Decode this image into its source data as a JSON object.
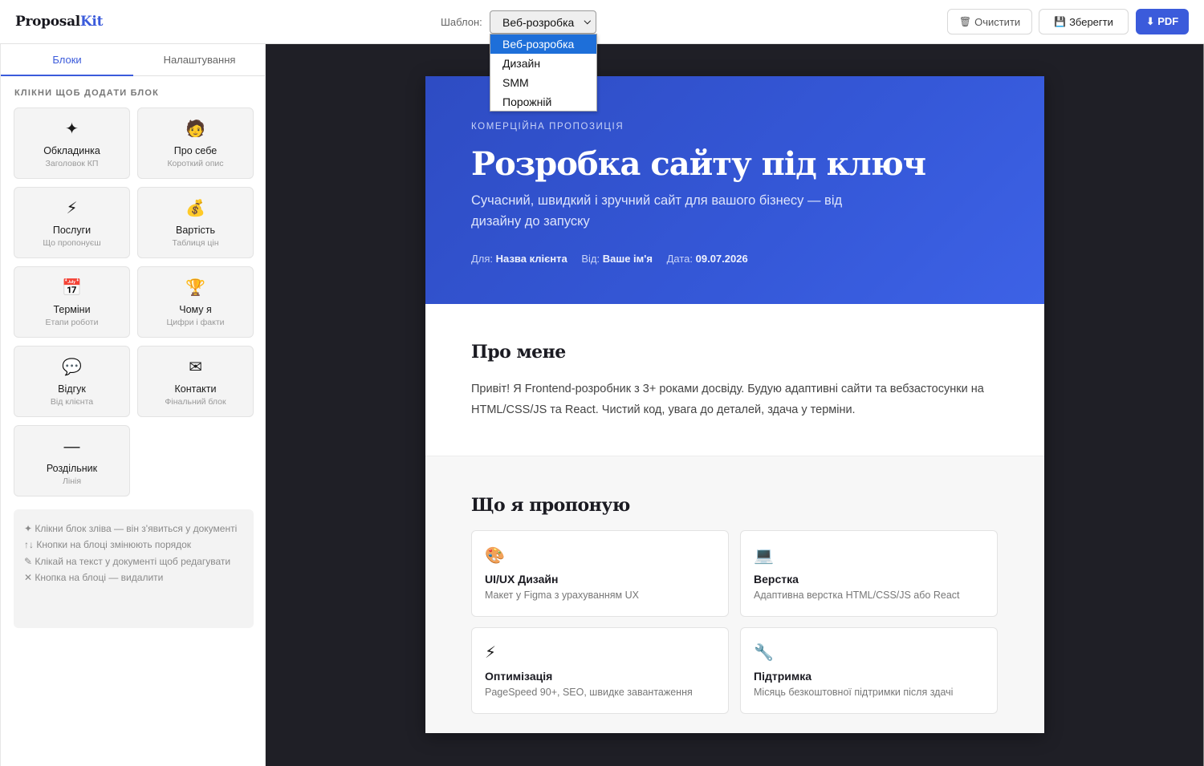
{
  "header": {
    "logo_part1": "Proposal",
    "logo_part2": "Kit",
    "template_label": "Шаблон:",
    "template_selected": "Веб-розробка",
    "template_options": [
      "Веб-розробка",
      "Дизайн",
      "SMM",
      "Порожній"
    ],
    "clear_icon": "trash-icon",
    "clear_label": "Очистити",
    "save_icon": "floppy-disk-icon",
    "save_label": "Зберегти",
    "pdf_label": "⬇ PDF"
  },
  "sidebar": {
    "tabs": [
      "Блоки",
      "Налаштування"
    ],
    "active_tab": "Блоки",
    "section_label": "КЛІКНИ ЩОБ ДОДАТИ БЛОК",
    "blocks": [
      {
        "icon": "✦",
        "icon_name": "sparkle-icon",
        "title": "Обкладинка",
        "subtitle": "Заголовок КП"
      },
      {
        "icon": "🧑",
        "icon_name": "person-icon",
        "title": "Про себе",
        "subtitle": "Короткий опис"
      },
      {
        "icon": "⚡",
        "icon_name": "lightning-icon",
        "title": "Послуги",
        "subtitle": "Що пропонуєш"
      },
      {
        "icon": "💰",
        "icon_name": "money-bag-icon",
        "title": "Вартість",
        "subtitle": "Таблиця цін"
      },
      {
        "icon": "📅",
        "icon_name": "calendar-icon",
        "title": "Терміни",
        "subtitle": "Етапи роботи"
      },
      {
        "icon": "🏆",
        "icon_name": "trophy-icon",
        "title": "Чому я",
        "subtitle": "Цифри і факти"
      },
      {
        "icon": "💬",
        "icon_name": "speech-bubble-icon",
        "title": "Відгук",
        "subtitle": "Від клієнта"
      },
      {
        "icon": "✉",
        "icon_name": "envelope-icon",
        "title": "Контакти",
        "subtitle": "Фінальний блок"
      },
      {
        "icon": "—",
        "icon_name": "divider-line-icon",
        "title": "Роздільник",
        "subtitle": "Лінія"
      }
    ],
    "hints": [
      "✦ Клікни блок зліва — він з'явиться у документі",
      "↑↓ Кнопки на блоці змінюють порядок",
      "✎ Клікай на текст у документі щоб редагувати",
      "✕ Кнопка на блоці — видалити"
    ]
  },
  "document": {
    "hero": {
      "eyebrow": "КОМЕРЦІЙНА ПРОПОЗИЦІЯ",
      "title": "Розробка сайту під ключ",
      "subtitle": "Сучасний, швидкий і зручний сайт для вашого бізнесу — від дизайну до запуску",
      "for_label": "Для:",
      "for_value": "Назва клієнта",
      "from_label": "Від:",
      "from_value": "Ваше ім'я",
      "date_label": "Дата:",
      "date_value": "09.07.2026",
      "accent_color": "#3558d8"
    },
    "about": {
      "title": "Про мене",
      "text": "Привіт! Я Frontend-розробник з 3+ роками досвіду. Будую адаптивні сайти та вебзастосунки на HTML/CSS/JS та React. Чистий код, увага до деталей, здача у терміни."
    },
    "services": {
      "title": "Що я пропоную",
      "items": [
        {
          "icon": "🎨",
          "icon_name": "palette-icon",
          "title": "UI/UX Дизайн",
          "subtitle": "Макет у Figma з урахуванням UX"
        },
        {
          "icon": "💻",
          "icon_name": "laptop-icon",
          "title": "Верстка",
          "subtitle": "Адаптивна верстка HTML/CSS/JS або React"
        },
        {
          "icon": "⚡",
          "icon_name": "lightning-icon",
          "title": "Оптимізація",
          "subtitle": "PageSpeed 90+, SEO, швидке завантаження"
        },
        {
          "icon": "🔧",
          "icon_name": "wrench-icon",
          "title": "Підтримка",
          "subtitle": "Місяць безкоштовної підтримки після здачі"
        }
      ]
    }
  }
}
